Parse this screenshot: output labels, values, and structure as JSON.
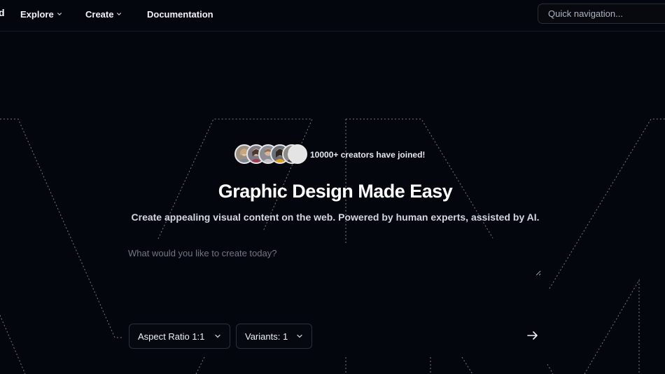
{
  "header": {
    "logo_fragment": "d",
    "nav": [
      {
        "label": "Explore",
        "has_dropdown": true
      },
      {
        "label": "Create",
        "has_dropdown": true
      },
      {
        "label": "Documentation",
        "has_dropdown": false
      }
    ],
    "search": {
      "placeholder": "Quick navigation..."
    }
  },
  "hero": {
    "social_proof": "10000+ creators have joined!",
    "title": "Graphic Design Made Easy",
    "subtitle": "Create appealing visual content on the web. Powered by human experts, assisted by AI."
  },
  "prompt": {
    "placeholder": "What would you like to create today?",
    "aspect_ratio_label": "Aspect Ratio 1:1",
    "variants_label": "Variants: 1"
  },
  "icons": {
    "dropdown": "chevron-down-icon",
    "send": "arrow-right-icon"
  },
  "colors": {
    "background": "#04060d",
    "text": "#ffffff",
    "muted_text": "#6f7684",
    "border": "#2a303c"
  }
}
